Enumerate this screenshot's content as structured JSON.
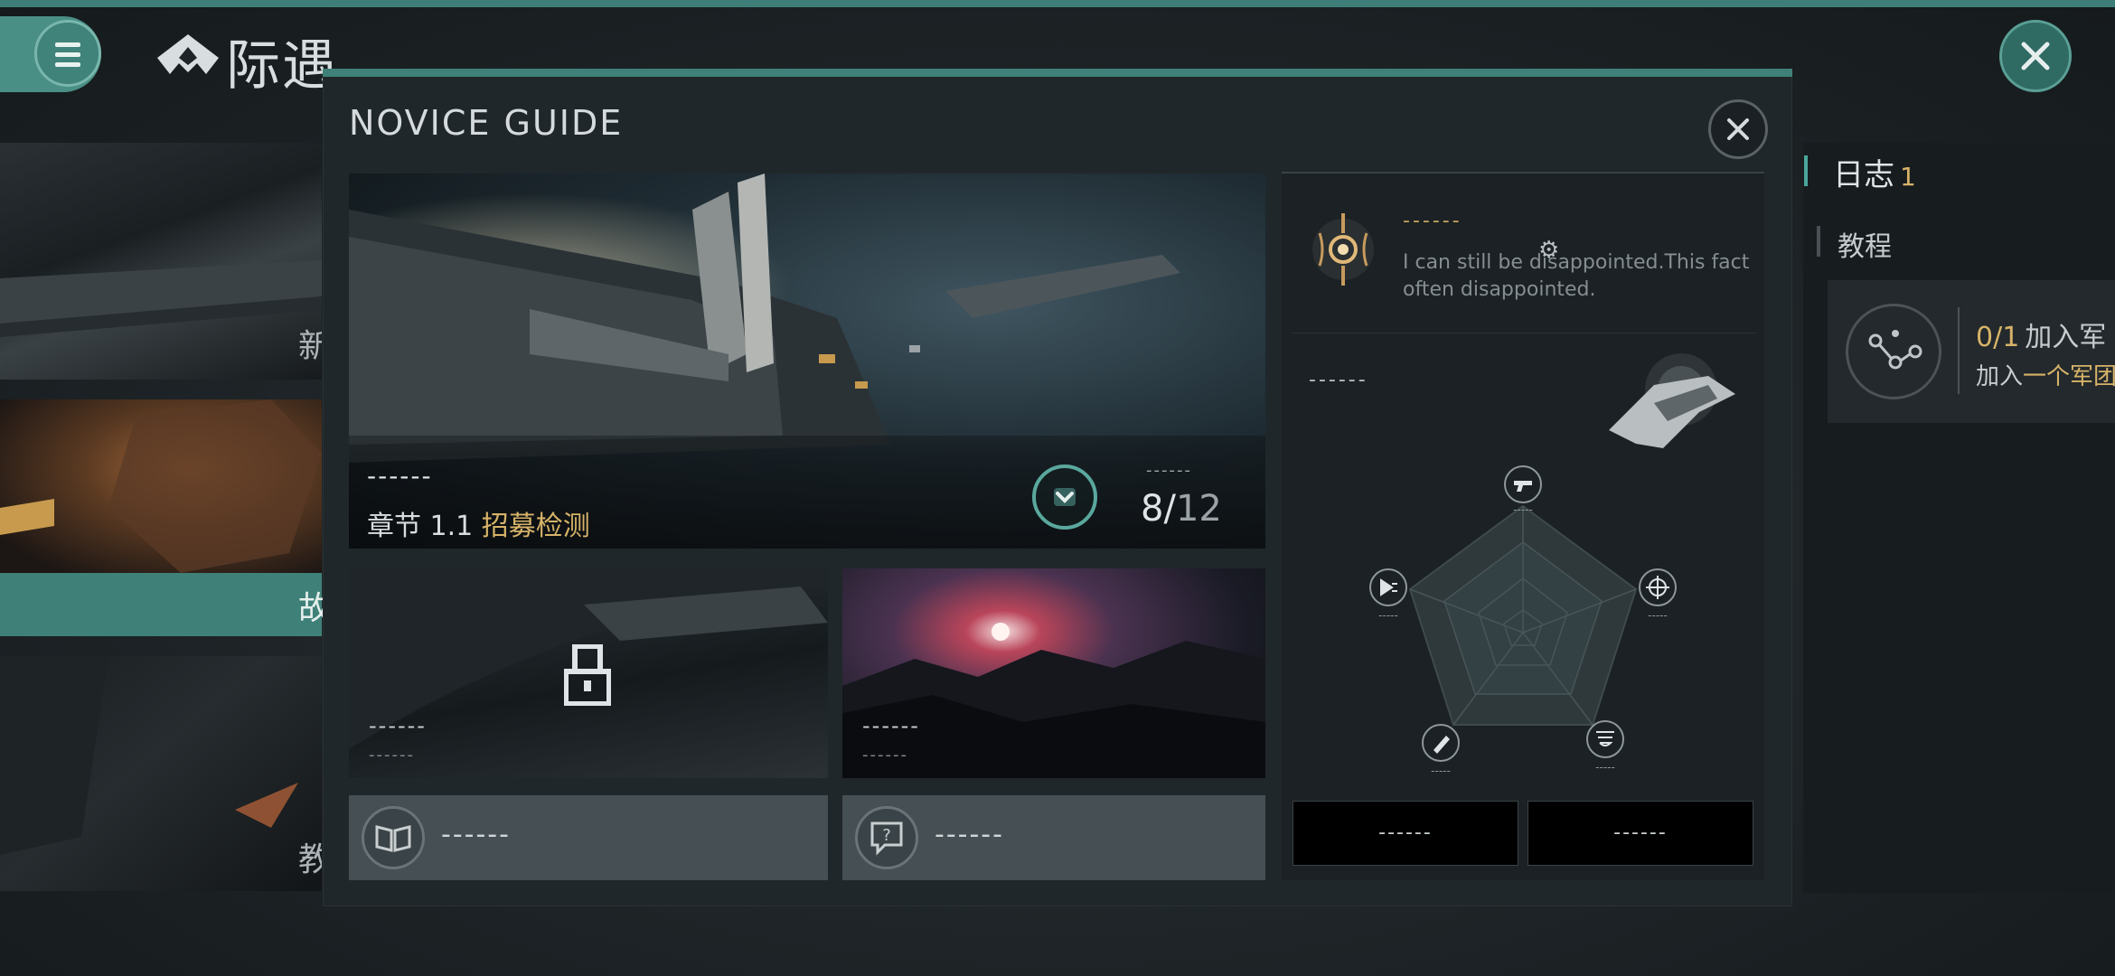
{
  "app": {
    "title": "际遇"
  },
  "left_cards": [
    {
      "text": "新"
    },
    {
      "text": "故"
    },
    {
      "text": "教"
    }
  ],
  "log_panel": {
    "title": "日志",
    "count": "1",
    "section": "教程",
    "task": {
      "progress": "0/1",
      "progress_text": "加入军",
      "desc_prefix": "加入",
      "desc_highlight": "一个军团"
    }
  },
  "dialog": {
    "title": "NOVICE GUIDE",
    "hero": {
      "dash": "------",
      "chapter_prefix": "章节 1.1 ",
      "chapter_name": "招募检测",
      "small_dash": "------",
      "count_current": "8/",
      "count_total": "12"
    },
    "cards": [
      {
        "dash": "------",
        "sub": "------",
        "locked": true
      },
      {
        "dash": "------",
        "sub": "------",
        "locked": false
      }
    ],
    "buttons": [
      {
        "label": "------",
        "icon": "book-icon"
      },
      {
        "label": "------",
        "icon": "help-icon"
      }
    ],
    "side": {
      "tip_dash": "------",
      "tip_text": "I can still be disappointed.This fact often disappointed.",
      "ship_dash": "------",
      "radar_labels": [
        "-----",
        "-----",
        "-----",
        "-----",
        "-----"
      ],
      "action_left": "------",
      "action_right": "------"
    }
  },
  "colors": {
    "accent": "#3f8179",
    "gold": "#d7b368"
  }
}
